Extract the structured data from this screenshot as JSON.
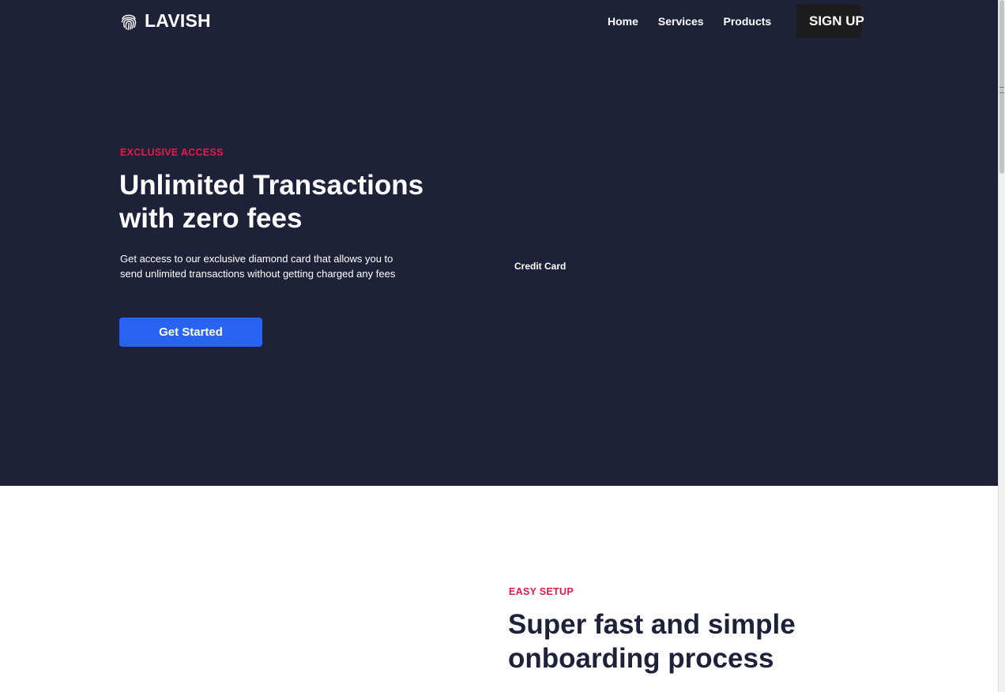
{
  "colors": {
    "hero_bg": "#1e2239",
    "accent": "#e6194b",
    "primary_button": "#2963f2",
    "signup_button": "#1c1c1f",
    "dark_heading": "#1e2239"
  },
  "nav": {
    "logo_icon": "fingerprint-icon",
    "logo_text": "LAVISH",
    "links": [
      {
        "label": "Home"
      },
      {
        "label": "Services"
      },
      {
        "label": "Products"
      }
    ],
    "signup_label": "SIGN UP"
  },
  "hero": {
    "eyebrow": "EXCLUSIVE ACCESS",
    "title": "Unlimited Transactions with zero fees",
    "description": "Get access to our exclusive diamond card that allows you to send unlimited transactions without getting charged any fees",
    "cta_label": "Get Started",
    "image_alt": "Credit Card"
  },
  "onboarding": {
    "eyebrow": "EASY SETUP",
    "title": "Super fast and simple onboarding process"
  }
}
